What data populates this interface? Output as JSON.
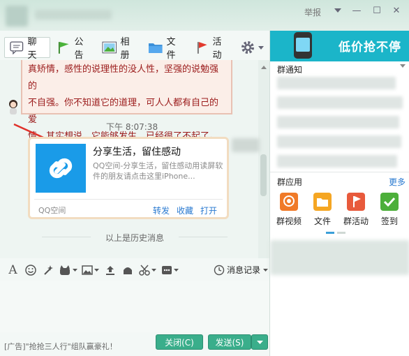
{
  "window": {
    "report_label": "举报",
    "minimize": "—",
    "maximize": "☐",
    "close": "✕"
  },
  "tabs": [
    {
      "label": "聊天",
      "icon": "chat-bubble-icon"
    },
    {
      "label": "公告",
      "icon": "flag-icon"
    },
    {
      "label": "相册",
      "icon": "photo-icon"
    },
    {
      "label": "文件",
      "icon": "folder-icon"
    },
    {
      "label": "活动",
      "icon": "red-flag-icon"
    }
  ],
  "chat": {
    "bubble_lines": [
      "真矫情，感性的说理性的没人性，坚强的说勉强的",
      "不自强。你不知道它的道理，可人人都有自己的爱",
      "情。其实想说，它能够发生，已经很了不起了。"
    ],
    "timestamp": "下午 8:07:38",
    "card": {
      "title": "分享生活，留住感动",
      "description": "QQ空间-分享生活，留住感动用读屏软件的朋友请点击这里iPhone...",
      "source": "QQ空间",
      "actions": [
        "转发",
        "收藏",
        "打开"
      ]
    },
    "history_label": "以上是历史消息"
  },
  "input_toolbar": {
    "message_record_label": "消息记录"
  },
  "footer": {
    "ad_text": "[广告]\"抢抢三人行\"组队赢豪礼！",
    "close_label": "关闭(C)",
    "send_label": "发送(S)"
  },
  "right_panel": {
    "ad_text": "低价抢不停",
    "notice_title": "群通知",
    "apps_title": "群应用",
    "more_label": "更多",
    "apps": [
      {
        "label": "群视频",
        "icon": "video-icon",
        "color": "#f07a28"
      },
      {
        "label": "文件",
        "icon": "folder-icon",
        "color": "#f5a623"
      },
      {
        "label": "群活动",
        "icon": "activity-icon",
        "color": "#e85a3c"
      },
      {
        "label": "签到",
        "icon": "checkin-icon",
        "color": "#4caf3a"
      }
    ]
  },
  "colors": {
    "accent": "#3aae8b",
    "link": "#2a7ad0",
    "bubble_text": "#9b1b1b",
    "card_thumb": "#1a9be8"
  }
}
